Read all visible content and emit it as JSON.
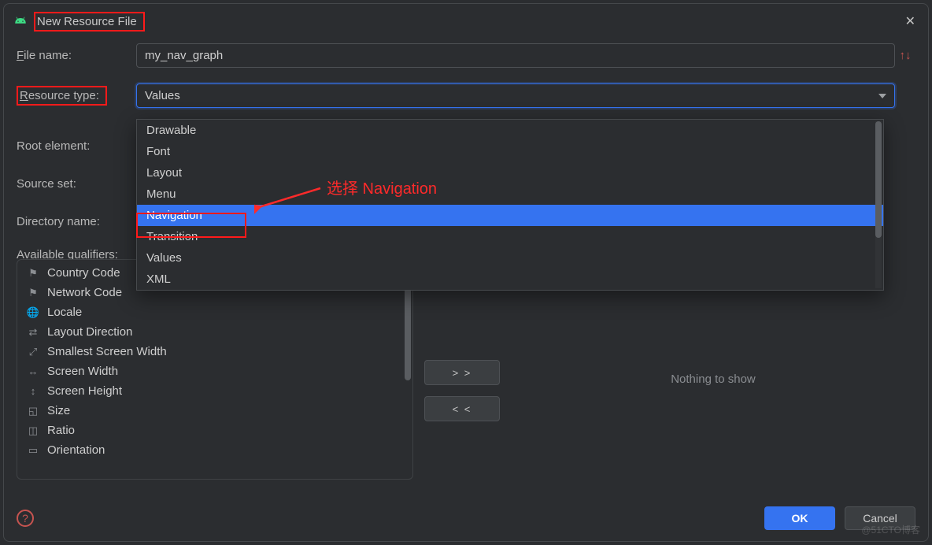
{
  "dialog_title": "New Resource File",
  "labels": {
    "file_name": "File name:",
    "resource_type": "Resource type:",
    "root_element": "Root element:",
    "source_set": "Source set:",
    "directory_name": "Directory name:",
    "available_qualifiers": "Available qualifiers:"
  },
  "file_name_value": "my_nav_graph",
  "resource_type_value": "Values",
  "dropdown_options": [
    "Drawable",
    "Font",
    "Layout",
    "Menu",
    "Navigation",
    "Transition",
    "Values",
    "XML"
  ],
  "dropdown_selected_index": 4,
  "qualifiers": [
    "Country Code",
    "Network Code",
    "Locale",
    "Layout Direction",
    "Smallest Screen Width",
    "Screen Width",
    "Screen Height",
    "Size",
    "Ratio",
    "Orientation"
  ],
  "transfer": {
    "add": "> >",
    "remove": "< <"
  },
  "chosen_placeholder": "Nothing to show",
  "buttons": {
    "ok": "OK",
    "cancel": "Cancel"
  },
  "annotation": "选择 Navigation",
  "watermark": "@51CTO博客"
}
